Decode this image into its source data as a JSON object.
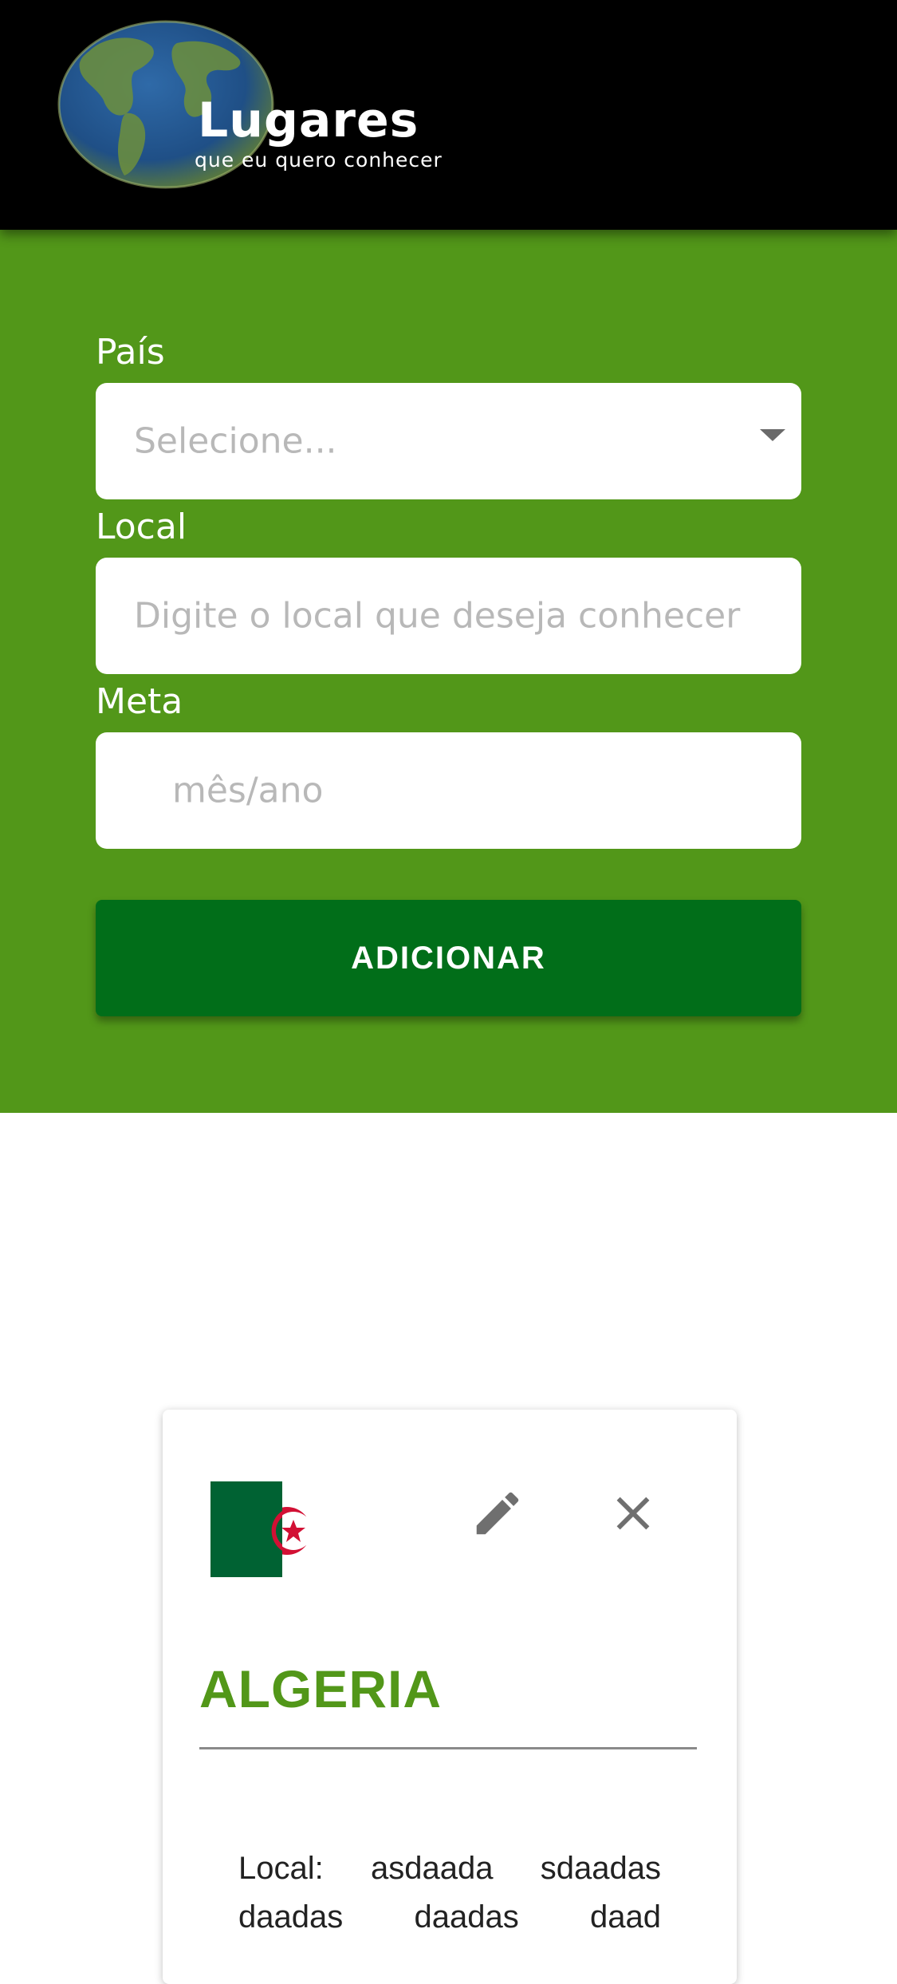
{
  "header": {
    "logo_title": "Lugares",
    "logo_subtitle": "que eu quero conhecer",
    "background_color": "#000000"
  },
  "form": {
    "background_color": "#529719",
    "country_label": "País",
    "country_placeholder": "Selecione...",
    "local_label": "Local",
    "local_placeholder": "Digite o local que deseja conhecer",
    "goal_label": "Meta",
    "goal_placeholder": "mês/ano",
    "submit_label": "ADICIONAR",
    "submit_color": "#016e19"
  },
  "cards": [
    {
      "flag": "algeria-flag",
      "country": "ALGERIA",
      "local_text": "Local: asdaada sdaadas daadas daadas daad",
      "edit_icon": "pencil-icon",
      "delete_icon": "close-icon",
      "accent_color": "#529719"
    }
  ]
}
